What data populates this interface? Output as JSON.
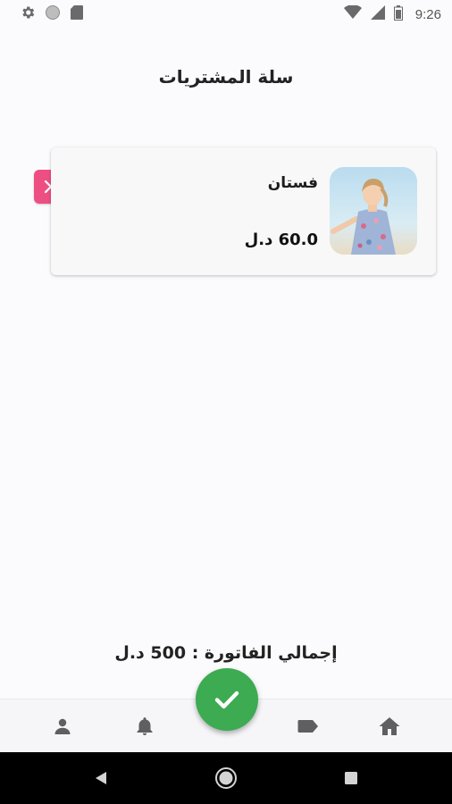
{
  "status_bar": {
    "time": "9:26",
    "icons": [
      "gear-icon",
      "circle-icon",
      "sd-card-icon",
      "wifi-icon",
      "signal-icon",
      "battery-icon"
    ]
  },
  "header": {
    "title": "سلة المشتريات"
  },
  "cart": {
    "items": [
      {
        "name": "فستان",
        "price": "60.0 د.ل",
        "thumbnail": "girl-in-floral-dress-photo"
      }
    ]
  },
  "summary": {
    "total_text": "إجمالي الفاتورة : 500 د.ل"
  },
  "bottom_nav": {
    "items": [
      "profile-icon",
      "bell-icon",
      "tag-icon",
      "home-icon"
    ],
    "fab_icon": "check-icon",
    "colors": {
      "fab": "#3cab52",
      "remove": "#ee4f83"
    }
  },
  "system_nav": {
    "buttons": [
      "back-icon",
      "home-circle-icon",
      "recents-icon"
    ]
  }
}
